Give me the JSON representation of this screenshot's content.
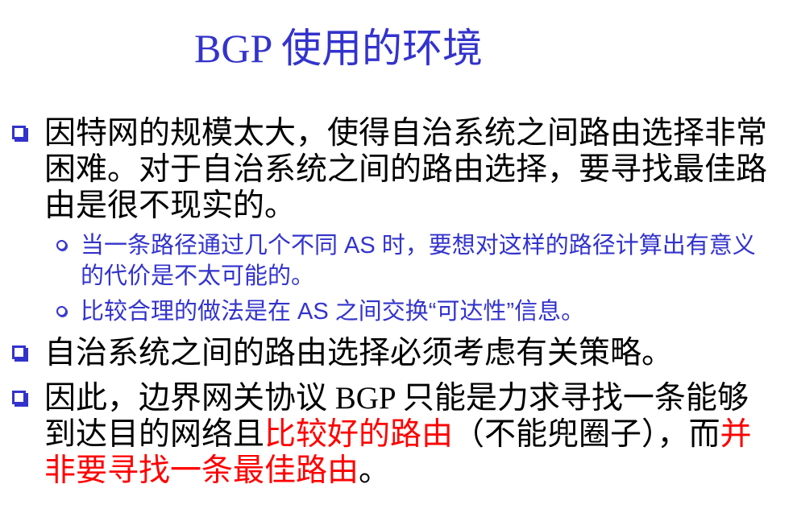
{
  "title": "BGP 使用的环境",
  "bullets": [
    {
      "text": "因特网的规模太大，使得自治系统之间路由选择非常困难。对于自治系统之间的路由选择，要寻找最佳路由是很不现实的。"
    },
    {
      "sub": [
        "当一条路径通过几个不同 AS 时，要想对这样的路径计算出有意义的代价是不太可能的。",
        "比较合理的做法是在 AS 之间交换“可达性”信息。"
      ]
    },
    {
      "text": "自治系统之间的路由选择必须考虑有关策略。"
    },
    {
      "parts": [
        "因此，边界网关协议 BGP 只能是力求寻找一条能够到达目的网络且",
        "比较好的路由",
        "（不能兜圈子），而",
        "并非要寻找一条最佳路由",
        "。"
      ]
    }
  ],
  "colors": {
    "accent": "#3333cc",
    "highlight": "#ff0000"
  }
}
